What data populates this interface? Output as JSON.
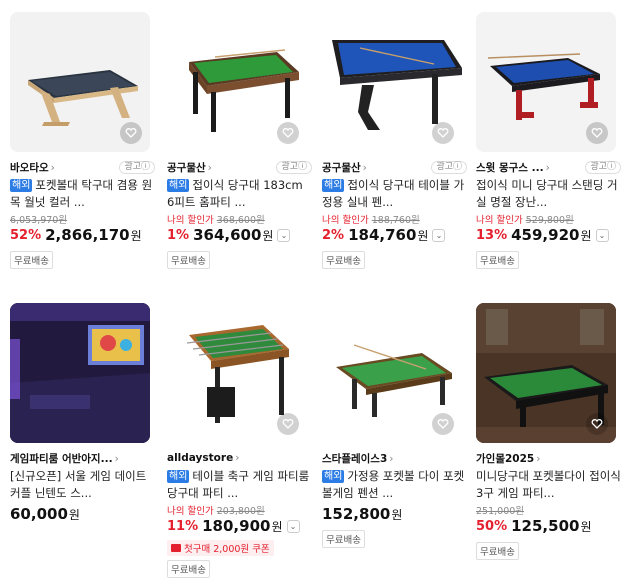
{
  "products": [
    {
      "store": "바오타오",
      "ad": "광고ⓘ",
      "oversea": "해외",
      "title": "포켓볼대 탁구대 겸용 원목 월넛 컬러 ...",
      "orig_label": "",
      "orig_price": "6,053,970원",
      "discount": "52%",
      "price": "2,866,170",
      "won": "원",
      "shipping": "무료배송",
      "coupon": ""
    },
    {
      "store": "공구물산",
      "ad": "광고ⓘ",
      "oversea": "해외",
      "title": "접이식 당구대 183cm 6피트 홈파티 ...",
      "orig_label": "나의 할인가",
      "orig_price": "368,600원",
      "discount": "1%",
      "price": "364,600",
      "won": "원",
      "shipping": "무료배송",
      "coupon": ""
    },
    {
      "store": "공구물산",
      "ad": "광고ⓘ",
      "oversea": "해외",
      "title": "접이식 당구대 테이블 가정용 실내 펜...",
      "orig_label": "나의 할인가",
      "orig_price": "188,760원",
      "discount": "2%",
      "price": "184,760",
      "won": "원",
      "shipping": "무료배송",
      "coupon": ""
    },
    {
      "store": "스윗 몽구스 ...",
      "ad": "광고ⓘ",
      "oversea": "",
      "title": "접이식 미니 당구대 스탠딩 거실 명절 장난...",
      "orig_label": "나의 할인가",
      "orig_price": "529,800원",
      "discount": "13%",
      "price": "459,920",
      "won": "원",
      "shipping": "무료배송",
      "coupon": ""
    },
    {
      "store": "게임파티룸 어반아지...",
      "ad": "",
      "oversea": "",
      "title": "[신규오픈] 서울 게임 데이트 커플 닌텐도 스...",
      "orig_label": "",
      "orig_price": "",
      "discount": "",
      "price": "60,000",
      "won": "원",
      "shipping": "",
      "coupon": ""
    },
    {
      "store": "alldaystore",
      "ad": "",
      "oversea": "해외",
      "title": "테이블 축구 게임 파티룸 당구대 파티 ...",
      "orig_label": "나의 할인가",
      "orig_price": "203,800원",
      "discount": "11%",
      "price": "180,900",
      "won": "원",
      "shipping": "무료배송",
      "coupon": "첫구매 2,000원 쿠폰"
    },
    {
      "store": "스타플레이스3",
      "ad": "",
      "oversea": "해외",
      "title": "가정용 포켓볼 다이 포켓볼게임 펜션 ...",
      "orig_label": "",
      "orig_price": "",
      "discount": "",
      "price": "152,800",
      "won": "원",
      "shipping": "무료배송",
      "coupon": ""
    },
    {
      "store": "가인몰2025",
      "ad": "",
      "oversea": "",
      "title": "미니당구대 포켓볼다이 접이식 3구 게임 파티...",
      "orig_label": "",
      "orig_price": "251,000원",
      "discount": "50%",
      "price": "125,500",
      "won": "원",
      "shipping": "무료배송",
      "coupon": ""
    }
  ]
}
